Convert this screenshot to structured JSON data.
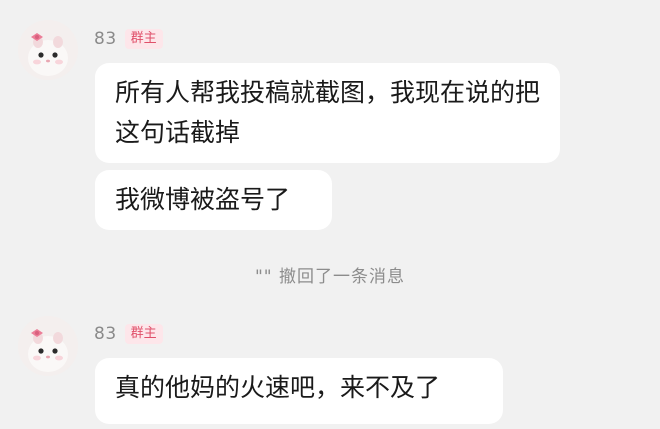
{
  "messages": [
    {
      "user": "83",
      "role": "群主",
      "bubbles": [
        "所有人帮我投稿就截图，我现在说的把这句话截掉",
        "我微博被盗号了"
      ]
    },
    {
      "user": "83",
      "role": "群主",
      "bubbles": [
        "真的他妈的火速吧，来不及了"
      ]
    }
  ],
  "system_notice": "\"\" 撤回了一条消息",
  "avatar_icon": "hamster-with-bow-icon",
  "colors": {
    "background": "#f1f1f1",
    "bubble": "#ffffff",
    "badge_text": "#e0506a",
    "badge_bg": "#fde6ea"
  }
}
